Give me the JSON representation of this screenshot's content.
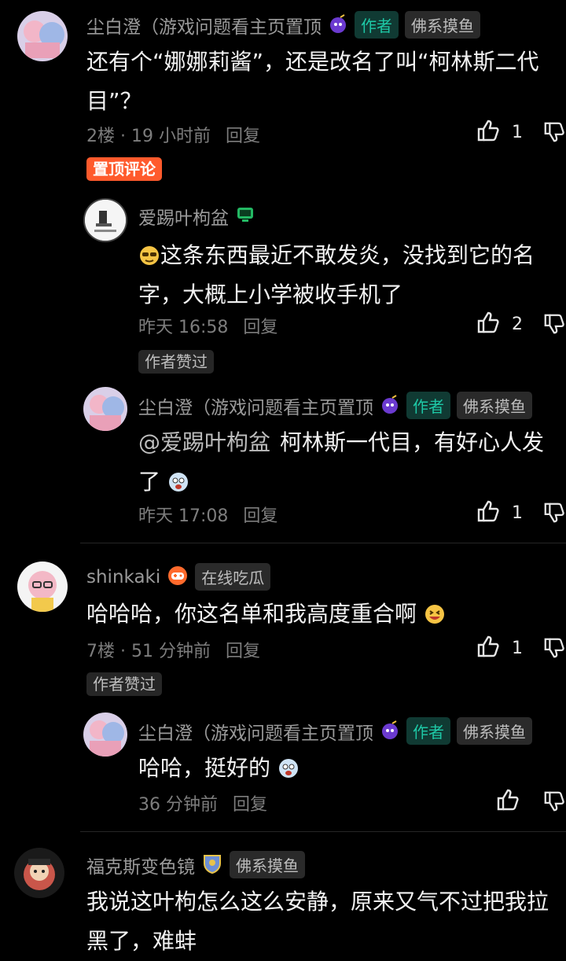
{
  "comments": [
    {
      "user": "尘白澄（游戏问题看主页置顶",
      "author_tag": "作者",
      "badge_tag": "佛系摸鱼",
      "content": "还有个“娜娜莉酱”，还是改名了叫“柯林斯二代目”？",
      "meta": "2楼 · 19 小时前",
      "reply": "回复",
      "likes": "1",
      "pinned_tag": "置顶评论",
      "replies": [
        {
          "user": "爱踢叶枸盆",
          "content": "这条东西最近不敢发炎，没找到它的名字，大概上小学被收手机了",
          "meta": "昨天 16:58",
          "reply": "回复",
          "likes": "2",
          "liked_tag": "作者赞过"
        },
        {
          "user": "尘白澄（游戏问题看主页置顶",
          "author_tag": "作者",
          "badge_tag": "佛系摸鱼",
          "mention": "@爱踢叶枸盆",
          "content": "柯林斯一代目，有好心人发了",
          "meta": "昨天 17:08",
          "reply": "回复",
          "likes": "1"
        }
      ]
    },
    {
      "user": "shinkaki",
      "badge_tag": "在线吃瓜",
      "content": "哈哈哈，你这名单和我高度重合啊",
      "meta": "7楼 · 51 分钟前",
      "reply": "回复",
      "likes": "1",
      "liked_tag": "作者赞过",
      "replies": [
        {
          "user": "尘白澄（游戏问题看主页置顶",
          "author_tag": "作者",
          "badge_tag": "佛系摸鱼",
          "content": "哈哈，挺好的",
          "meta": "36 分钟前",
          "reply": "回复"
        }
      ]
    },
    {
      "user": "福克斯变色镜",
      "badge_tag": "佛系摸鱼",
      "content": "我说这叶枸怎么这么安静，原来又气不过把我拉黑了，难蚌"
    }
  ],
  "colors": {
    "accent": "#1ec8a6",
    "pin": "#ff5a2c",
    "bg": "#000000"
  }
}
